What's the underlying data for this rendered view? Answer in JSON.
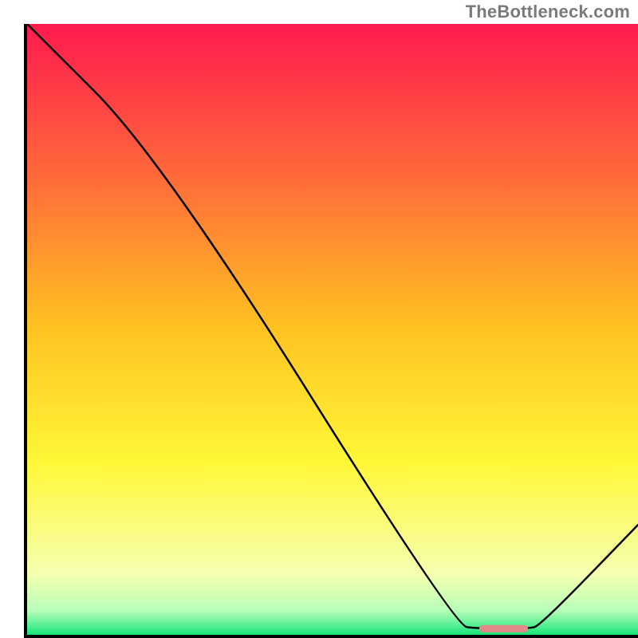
{
  "watermark": "TheBottleneck.com",
  "chart_data": {
    "type": "line",
    "title": "",
    "xlabel": "",
    "ylabel": "",
    "xlim": [
      0,
      100
    ],
    "ylim": [
      0,
      100
    ],
    "x": [
      0,
      22,
      70,
      74,
      82,
      84,
      100
    ],
    "values": [
      100,
      78,
      1.5,
      1,
      1,
      1.5,
      18
    ],
    "gradient_stops": [
      {
        "pos": 0.0,
        "color": "#ff1a4f"
      },
      {
        "pos": 0.25,
        "color": "#ff6a3a"
      },
      {
        "pos": 0.5,
        "color": "#ffc321"
      },
      {
        "pos": 0.72,
        "color": "#fff839"
      },
      {
        "pos": 0.9,
        "color": "#f6ffb0"
      },
      {
        "pos": 0.96,
        "color": "#b8ffb8"
      },
      {
        "pos": 1.0,
        "color": "#17e57a"
      }
    ],
    "marker": {
      "x_start": 74,
      "x_end": 82,
      "y": 1,
      "color": "#e28a8a",
      "thickness_pct": 1.2
    }
  }
}
